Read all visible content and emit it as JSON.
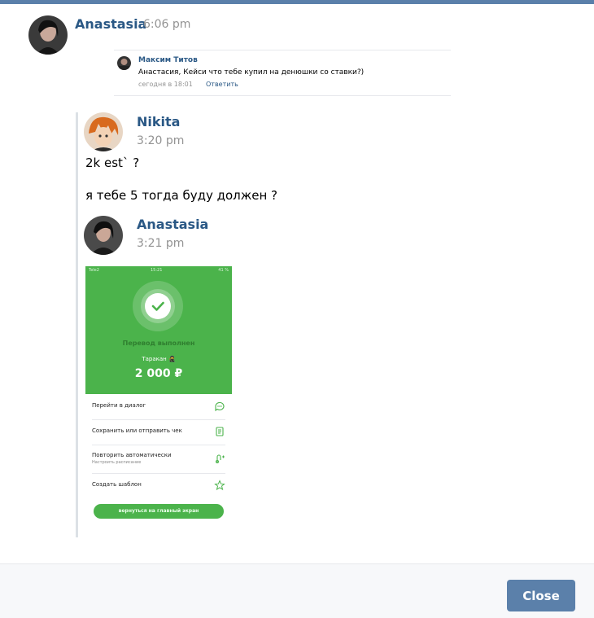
{
  "post": {
    "author": "Anastasia",
    "time": "6:06 pm"
  },
  "quoted_comment": {
    "author": "Максим Титов",
    "text": "Анастасия, Кейси что тебе купил на денюшки со ставки?)",
    "date": "сегодня в 18:01",
    "reply": "Ответить"
  },
  "forwarded": {
    "messages": [
      {
        "author": "Nikita",
        "time": "3:20 pm",
        "lines": [
          "2k est` ?",
          "я тебе 5 тогда буду должен ?"
        ]
      },
      {
        "author": "Anastasia",
        "time": "3:21 pm"
      }
    ]
  },
  "transfer_screenshot": {
    "status_left": "Tele2",
    "status_center": "15:21",
    "status_right": "41 %",
    "status": "Перевод выполнен",
    "recipient": "Таракан 🥷",
    "amount": "2 000 ₽",
    "actions": [
      {
        "label": "Перейти в диалог",
        "icon": "chat-icon"
      },
      {
        "label": "Сохранить или отправить чек",
        "icon": "receipt-icon"
      },
      {
        "label": "Повторить автоматически",
        "sublabel": "Настроить расписание",
        "icon": "repeat-icon"
      },
      {
        "label": "Создать шаблон",
        "icon": "star-icon"
      }
    ],
    "main_button": "вернуться на главный экран",
    "accent_color": "#4bb34b"
  },
  "footer": {
    "close_label": "Close"
  },
  "colors": {
    "name": "#2a5885",
    "button": "#5b80aa"
  }
}
